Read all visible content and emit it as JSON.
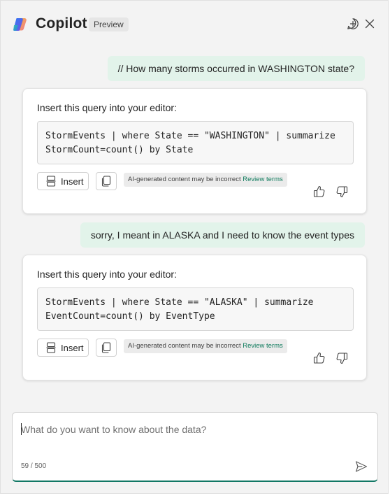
{
  "header": {
    "title": "Copilot",
    "badge": "Preview",
    "icons": {
      "new_chat": "new-chat-icon",
      "close": "close-icon",
      "logo": "copilot-logo"
    }
  },
  "conversation": [
    {
      "user": "// How many storms occurred in WASHINGTON state?",
      "response": {
        "intro": "Insert this query into your editor:",
        "code_line1": "StormEvents | where State == \"WASHINGTON\" | summarize",
        "code_line2": "StormCount=count() by State",
        "insert_label": "Insert",
        "disclaimer": "AI-generated content may be incorrect",
        "review_link": "Review terms"
      }
    },
    {
      "user": "sorry, I meant in ALASKA and I need to know the event types",
      "response": {
        "intro": "Insert this query into your editor:",
        "code_line1": "StormEvents | where State == \"ALASKA\" | summarize",
        "code_line2": "EventCount=count() by EventType",
        "insert_label": "Insert",
        "disclaimer": "AI-generated content may be incorrect",
        "review_link": "Review terms"
      }
    }
  ],
  "input": {
    "placeholder": "What do you want to know about the data?",
    "value": "",
    "char_count": "59 / 500"
  },
  "colors": {
    "user_bubble": "#e2f3ea",
    "accent": "#117865",
    "link": "#107c5e"
  }
}
